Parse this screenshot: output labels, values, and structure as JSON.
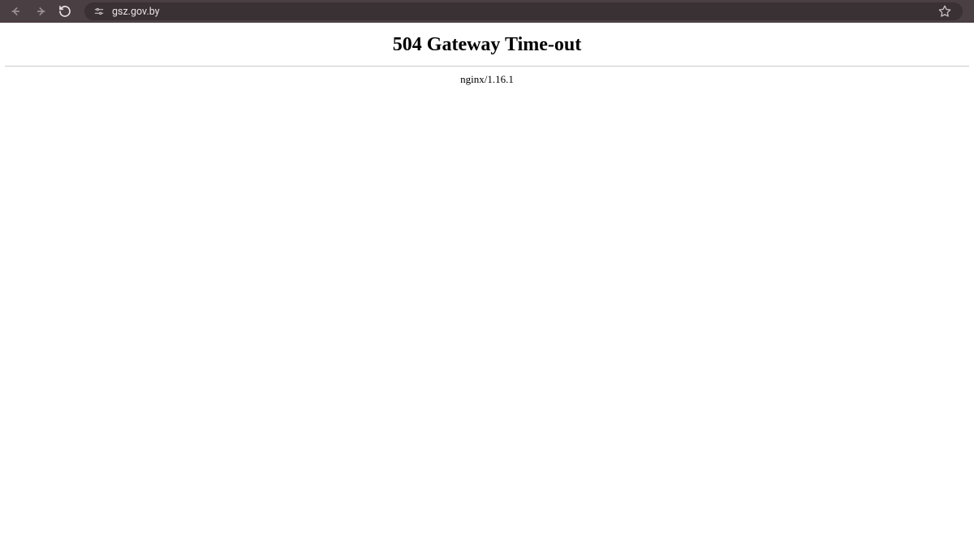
{
  "browser": {
    "url": "gsz.gov.by"
  },
  "error": {
    "heading": "504 Gateway Time-out",
    "server": "nginx/1.16.1"
  }
}
